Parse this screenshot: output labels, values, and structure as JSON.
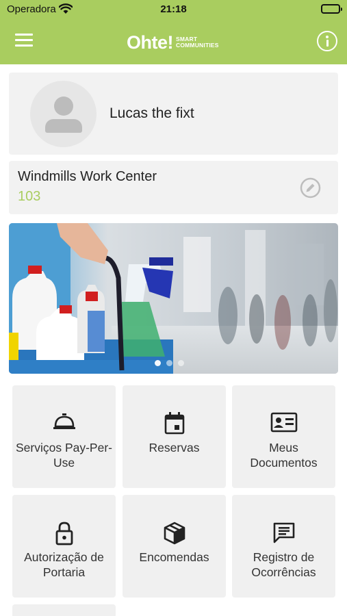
{
  "status_bar": {
    "carrier": "Operadora",
    "time": "21:18"
  },
  "nav": {
    "logo_main": "Ohte!",
    "logo_sub_line1": "SMART",
    "logo_sub_line2": "COMMUNITIES",
    "menu_icon": "hamburger-menu-icon",
    "info_icon": "info-icon"
  },
  "profile": {
    "name": "Lucas the fixt"
  },
  "unit": {
    "name": "Windmills Work Center",
    "number": "103"
  },
  "banner": {
    "slides": 3,
    "active_slide": 0
  },
  "services": [
    {
      "label": "Serviços Pay-Per-Use",
      "icon": "service-bell-icon"
    },
    {
      "label": "Reservas",
      "icon": "calendar-icon"
    },
    {
      "label": "Meus Documentos",
      "icon": "id-card-icon"
    },
    {
      "label": "Autorização de Portaria",
      "icon": "lock-icon"
    },
    {
      "label": "Encomendas",
      "icon": "package-icon"
    },
    {
      "label": "Registro de Ocorrências",
      "icon": "message-icon"
    }
  ],
  "colors": {
    "brand_green": "#a9cd5f",
    "card_bg": "#f2f2f2"
  }
}
